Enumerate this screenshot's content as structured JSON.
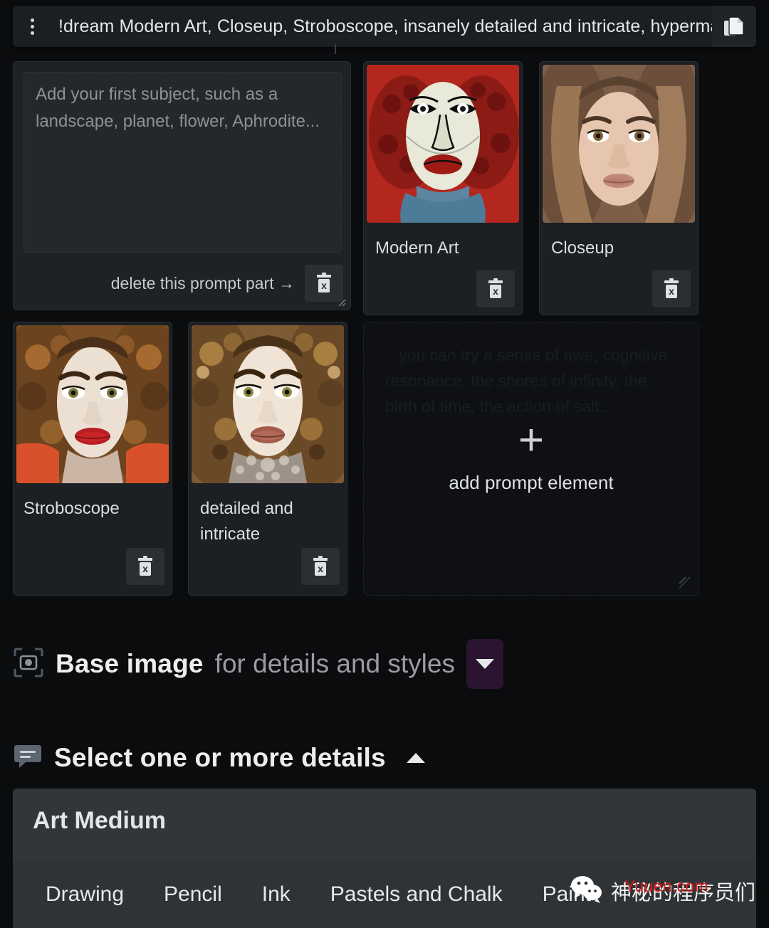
{
  "topbar": {
    "menu_icon": "kebab-menu-icon",
    "prompt": "!dream Modern Art, Closeup, Stroboscope, insanely detailed and intricate, hypermax",
    "copy_icon": "copy-icon"
  },
  "subject_card": {
    "placeholder": "Add your first subject, such as a landscape, planet, flower, Aphrodite...",
    "value": "",
    "delete_hint": "delete this prompt part →",
    "trash_icon": "trash-x-icon"
  },
  "prompt_elements": [
    {
      "label": "Modern Art",
      "trash_icon": "trash-x-icon"
    },
    {
      "label": "Closeup",
      "trash_icon": "trash-x-icon"
    },
    {
      "label": "Stroboscope",
      "trash_icon": "trash-x-icon"
    },
    {
      "label": "detailed and intricate",
      "trash_icon": "trash-x-icon"
    }
  ],
  "add_card": {
    "ghost_text": "...you can try a sense of awe, cognitive resonance, the shores of infinity, the birth of time, the action of salt...",
    "plus": "+",
    "label": "add prompt element",
    "resize_icon": "resize-handle-icon"
  },
  "base_image_section": {
    "icon": "focus-frame-camera-icon",
    "title": "Base image",
    "subtitle": "for details and styles",
    "chevron": "chevron-down-icon",
    "accent": "#2a1430"
  },
  "details_section": {
    "icon": "speech-bubble-icon",
    "title": "Select one or more details",
    "chevron": "chevron-up-icon"
  },
  "details_panel": {
    "title": "Art Medium",
    "tabs": [
      {
        "label": "Drawing"
      },
      {
        "label": "Pencil"
      },
      {
        "label": "Ink"
      },
      {
        "label": "Pastels and Chalk"
      },
      {
        "label": "Paint"
      }
    ]
  },
  "watermark": {
    "icon": "wechat-icon",
    "text": "神秘的程序员们",
    "url": "Yuuen.com",
    "url_color": "#e01b1b"
  }
}
